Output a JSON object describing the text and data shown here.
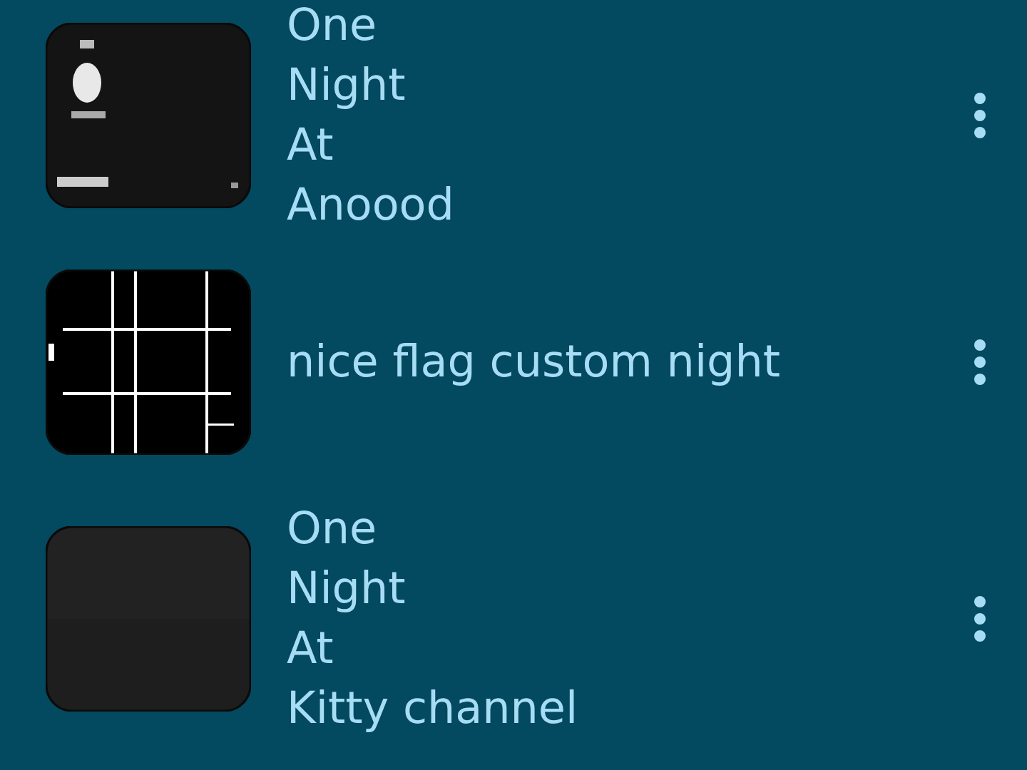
{
  "items": [
    {
      "title": "One\nNight\nAt\nAnoood"
    },
    {
      "title": "nice flag custom night"
    },
    {
      "title": "One\nNight\nAt\nKitty channel"
    }
  ]
}
